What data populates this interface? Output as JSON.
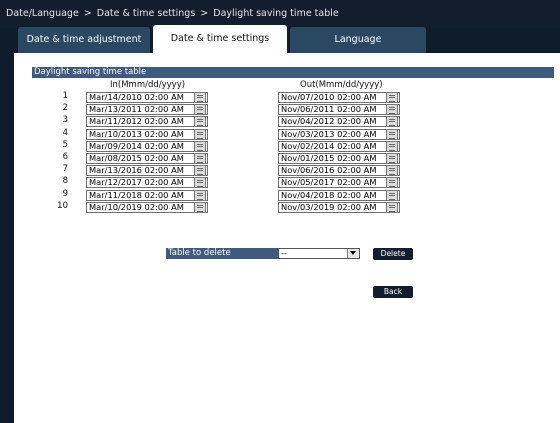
{
  "breadcrumb": {
    "items": [
      "Date/Language",
      "Date & time settings",
      "Daylight saving time table"
    ],
    "separator": ">"
  },
  "tabs": [
    {
      "label": "Date & time adjustment",
      "active": false
    },
    {
      "label": "Date & time settings",
      "active": true
    },
    {
      "label": "Language",
      "active": false
    }
  ],
  "section_title": "Daylight saving time table",
  "columns": {
    "in": "In(Mmm/dd/yyyy)",
    "out": "Out(Mmm/dd/yyyy)"
  },
  "rows": [
    {
      "no": "1",
      "in": "Mar/14/2010 02:00 AM",
      "out": "Nov/07/2010 02:00 AM"
    },
    {
      "no": "2",
      "in": "Mar/13/2011 02:00 AM",
      "out": "Nov/06/2011 02:00 AM"
    },
    {
      "no": "3",
      "in": "Mar/11/2012 02:00 AM",
      "out": "Nov/04/2012 02:00 AM"
    },
    {
      "no": "4",
      "in": "Mar/10/2013 02:00 AM",
      "out": "Nov/03/2013 02:00 AM"
    },
    {
      "no": "5",
      "in": "Mar/09/2014 02:00 AM",
      "out": "Nov/02/2014 02:00 AM"
    },
    {
      "no": "6",
      "in": "Mar/08/2015 02:00 AM",
      "out": "Nov/01/2015 02:00 AM"
    },
    {
      "no": "7",
      "in": "Mar/13/2016 02:00 AM",
      "out": "Nov/06/2016 02:00 AM"
    },
    {
      "no": "8",
      "in": "Mar/12/2017 02:00 AM",
      "out": "Nov/05/2017 02:00 AM"
    },
    {
      "no": "9",
      "in": "Mar/11/2018 02:00 AM",
      "out": "Nov/04/2018 02:00 AM"
    },
    {
      "no": "10",
      "in": "Mar/10/2019 02:00 AM",
      "out": "Nov/03/2019 02:00 AM"
    }
  ],
  "delete_table": {
    "label": "Table to delete",
    "selected": "--"
  },
  "buttons": {
    "delete": "Delete",
    "back": "Back"
  },
  "icons": {
    "date_picker": "calendar-icon",
    "dropdown": "chevron-down-icon"
  },
  "colors": {
    "header_bg": "#121e2d",
    "tab_inactive": "#2a4862",
    "section_bar": "#3f5a7c",
    "panel": "#ffffff"
  }
}
